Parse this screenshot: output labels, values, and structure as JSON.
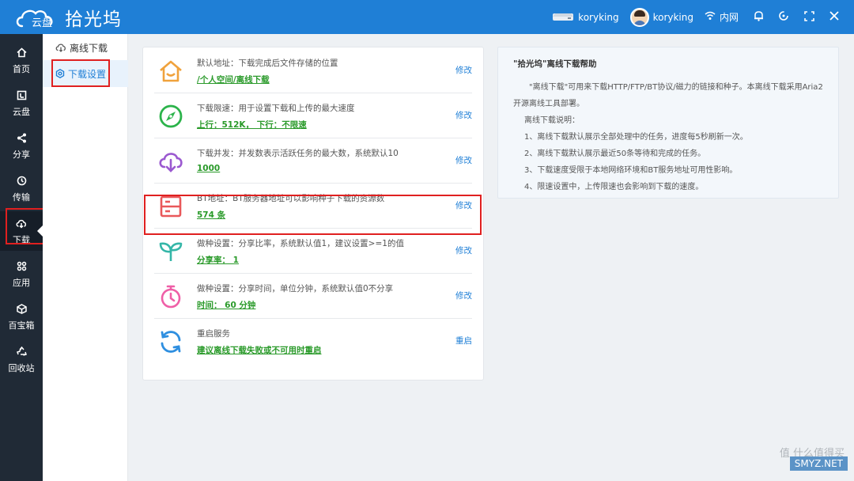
{
  "app": {
    "logo_small": "云盘",
    "name": "拾光坞"
  },
  "topbar": {
    "device_name": "koryking",
    "user_name": "koryking",
    "network_label": "内网"
  },
  "leftnav": {
    "items": [
      {
        "label": "首页",
        "icon": "home-icon"
      },
      {
        "label": "云盘",
        "icon": "cloud-drive-icon"
      },
      {
        "label": "分享",
        "icon": "share-icon"
      },
      {
        "label": "传输",
        "icon": "transfer-icon"
      },
      {
        "label": "下载",
        "icon": "download-icon"
      },
      {
        "label": "应用",
        "icon": "apps-icon"
      },
      {
        "label": "百宝箱",
        "icon": "toolbox-icon"
      },
      {
        "label": "回收站",
        "icon": "recycle-icon"
      }
    ],
    "active_index": 4
  },
  "subnav": {
    "items": [
      {
        "label": "离线下载",
        "icon": "cloud-download-icon"
      },
      {
        "label": "下载设置",
        "icon": "settings-icon"
      }
    ],
    "active_index": 1
  },
  "settings": {
    "rows": [
      {
        "desc": "默认地址：下载完成后文件存储的位置",
        "value": "/个人空间/离线下载",
        "action": "修改",
        "icon": "home-icon",
        "color": "#f0a23c"
      },
      {
        "desc": "下载限速：用于设置下载和上传的最大速度",
        "value": "上行：512K，  下行：不限速",
        "action": "修改",
        "icon": "compass-icon",
        "color": "#2bb34a"
      },
      {
        "desc": "下载并发：并发数表示活跃任务的最大数，系统默认10",
        "value": "1000",
        "action": "修改",
        "icon": "cloud-download-icon",
        "color": "#9b59d0"
      },
      {
        "desc": "BT地址：BT服务器地址可以影响种子下载的资源数",
        "value": "574 条",
        "action": "修改",
        "icon": "server-icon",
        "color": "#e9585a"
      },
      {
        "desc": "做种设置：分享比率，系统默认值1，建议设置>=1的值",
        "value": "分享率：  1",
        "action": "修改",
        "icon": "sprout-icon",
        "color": "#35b6a8"
      },
      {
        "desc": "做种设置：分享时间，单位分钟，系统默认值0不分享",
        "value": "时间：  60 分钟",
        "action": "修改",
        "icon": "timer-icon",
        "color": "#ef5fa7"
      },
      {
        "desc": "重启服务",
        "value": "建议离线下载失败或不可用时重启",
        "action": "重启",
        "icon": "restart-icon",
        "color": "#2f8fe0"
      }
    ]
  },
  "help": {
    "title": "\"拾光坞\"离线下载帮助",
    "intro_1": "\"离线下载\"可用来下载HTTP/FTP/BT协议/磁力的链接和种子。本离线下载采用Aria2",
    "intro_2": "开源离线工具部署。",
    "notes_title": "离线下载说明：",
    "notes": [
      "1、离线下载默认展示全部处理中的任务，进度每5秒刷新一次。",
      "2、离线下载默认展示最近50条等待和完成的任务。",
      "3、下载速度受限于本地网络环境和BT服务地址可用性影响。",
      "4、限速设置中，上传限速也会影响到下载的速度。"
    ]
  },
  "watermark": {
    "text": "值 什么值得买",
    "badge": "SMYZ.NET"
  },
  "colors": {
    "topbar": "#1f7fd6",
    "leftnav": "#202a36",
    "highlight": "#e02020",
    "link": "#1f7fd6",
    "value": "#2a9a2a"
  }
}
